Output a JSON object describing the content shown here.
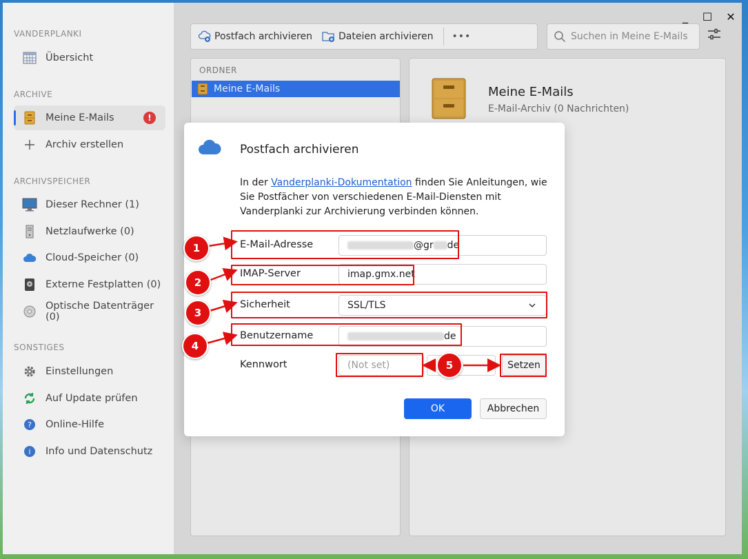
{
  "window": {
    "controls": {
      "minimize": "_",
      "maximize": "☐",
      "close": "✕"
    }
  },
  "sidebar": {
    "section_app": "VANDERPLANKI",
    "overview": "Übersicht",
    "section_archive": "ARCHIVE",
    "archive_item": "Meine E-Mails",
    "archive_alert": "!",
    "create_archive": "Archiv erstellen",
    "section_storage": "ARCHIVSPEICHER",
    "storage_items": [
      "Dieser Rechner (1)",
      "Netzlaufwerke (0)",
      "Cloud-Speicher (0)",
      "Externe Festplatten (0)",
      "Optische Datenträger (0)"
    ],
    "section_misc": "SONSTIGES",
    "misc_items": [
      "Einstellungen",
      "Auf Update prüfen",
      "Online-Hilfe",
      "Info und Datenschutz"
    ]
  },
  "toolbar": {
    "archive_mailbox": "Postfach archivieren",
    "archive_files": "Dateien archivieren",
    "more": "•••",
    "search_placeholder": "Suchen in Meine E-Mails"
  },
  "folders": {
    "header": "ORDNER",
    "selected": "Meine E-Mails"
  },
  "detail": {
    "title": "Meine E-Mails",
    "subtitle": "E-Mail-Archiv (0 Nachrichten)"
  },
  "dialog": {
    "title": "Postfach archivieren",
    "text_before_link": "In der ",
    "link": "Vanderplanki-Dokumentation",
    "text_after_link": " finden Sie Anleitungen, wie Sie Postfächer von verschiedenen E-Mail-Diensten mit Vanderplanki zur Archivierung verbinden können.",
    "fields": {
      "email_label": "E-Mail-Adresse",
      "email_visible_a": "@gr",
      "email_visible_b": "de",
      "imap_label": "IMAP-Server",
      "imap_value": "imap.gmx.net",
      "security_label": "Sicherheit",
      "security_value": "SSL/TLS",
      "user_label": "Benutzername",
      "user_visible": "de",
      "password_label": "Kennwort",
      "password_placeholder": "(Not set)",
      "set_button": "Setzen"
    },
    "ok": "OK",
    "cancel": "Abbrechen"
  },
  "annotations": {
    "numbers": [
      "1",
      "2",
      "3",
      "4",
      "5"
    ],
    "color": "#e01010"
  }
}
